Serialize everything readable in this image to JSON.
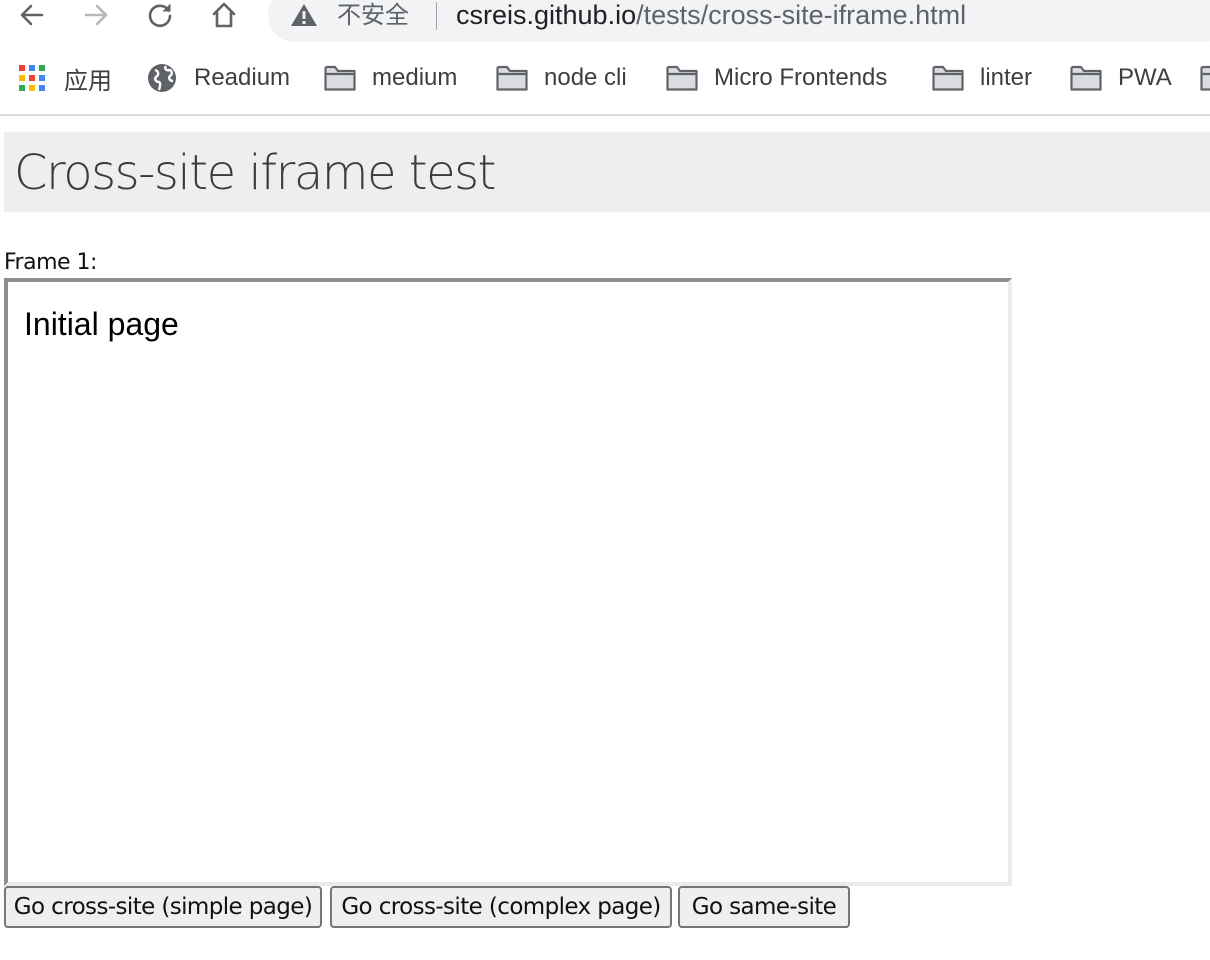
{
  "browser": {
    "nav": {
      "back_icon": "arrow-left-icon",
      "forward_icon": "arrow-right-icon",
      "reload_icon": "reload-icon",
      "home_icon": "home-icon"
    },
    "omnibox": {
      "security_icon": "warning-triangle-icon",
      "security_label": "不安全",
      "url_host": "csreis.github.io",
      "url_path": "/tests/cross-site-iframe.html"
    }
  },
  "bookmarks": {
    "items": [
      {
        "label": "应用",
        "icon": "apps-grid-icon"
      },
      {
        "label": "Readium",
        "icon": "globe-icon"
      },
      {
        "label": "medium",
        "icon": "folder-icon"
      },
      {
        "label": "node cli",
        "icon": "folder-icon"
      },
      {
        "label": "Micro Frontends",
        "icon": "folder-icon"
      },
      {
        "label": "linter",
        "icon": "folder-icon"
      },
      {
        "label": "PWA",
        "icon": "folder-icon"
      }
    ]
  },
  "page": {
    "title": "Cross-site iframe test",
    "frame_label": "Frame 1:",
    "iframe_text": "Initial page",
    "buttons": [
      "Go cross-site (simple page)",
      "Go cross-site (complex page)",
      "Go same-site"
    ]
  },
  "colors": {
    "header_bg": "#eeeeee",
    "omnibox_bg": "#f1f3f4",
    "button_bg": "#efefef"
  }
}
